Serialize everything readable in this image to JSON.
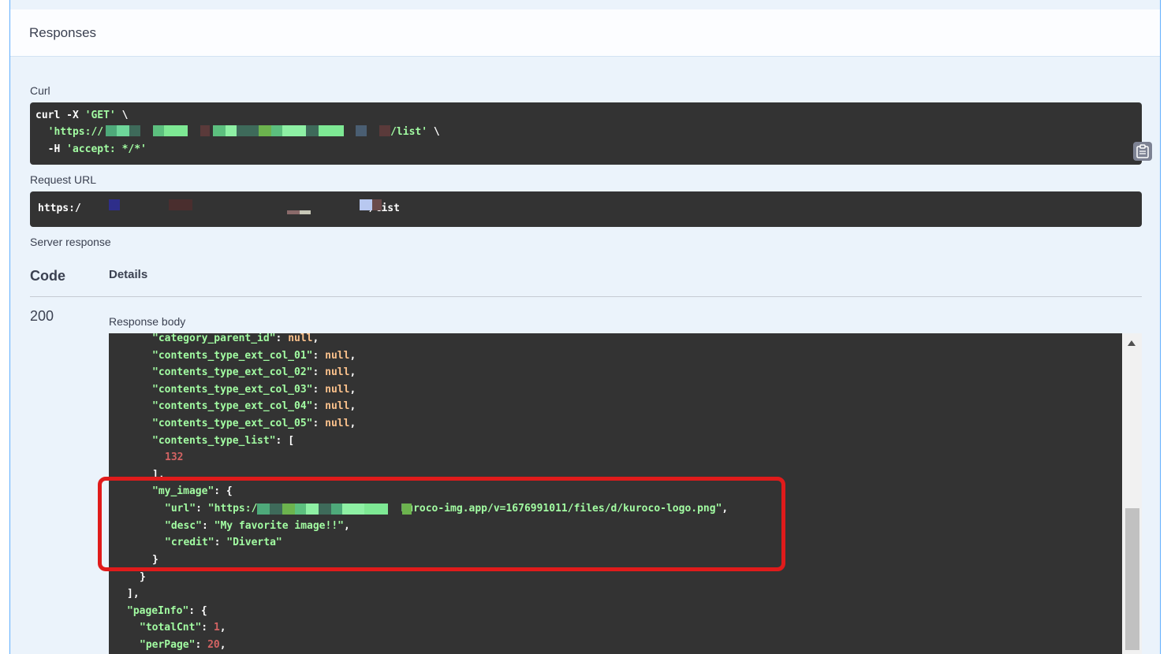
{
  "responses": {
    "title": "Responses"
  },
  "curl": {
    "label": "Curl",
    "line1_cmd": "curl -X ",
    "line1_method": "'GET'",
    "line1_end": " \\",
    "line2_prefix": "  'https://",
    "line2_suffix": "/list'",
    "line2_end": " \\",
    "line3_flag": "  -H ",
    "line3_value": "'accept: */*'"
  },
  "request_url": {
    "label": "Request URL",
    "prefix": "https:/",
    "suffix": "/list"
  },
  "server_response": {
    "label": "Server response",
    "code_header": "Code",
    "details_header": "Details",
    "code": "200",
    "body_label": "Response body"
  },
  "response_body": {
    "l1_key": "\"category_parent_id\"",
    "l1_val": "null",
    "l2_key": "\"contents_type_ext_col_01\"",
    "l2_val": "null",
    "l3_key": "\"contents_type_ext_col_02\"",
    "l3_val": "null",
    "l4_key": "\"contents_type_ext_col_03\"",
    "l4_val": "null",
    "l5_key": "\"contents_type_ext_col_04\"",
    "l5_val": "null",
    "l6_key": "\"contents_type_ext_col_05\"",
    "l6_val": "null",
    "l7_key": "\"contents_type_list\"",
    "l8_num": "132",
    "l10_key": "\"my_image\"",
    "l11_key": "\"url\"",
    "l11_val_prefix": "\"https:/",
    "l11_val_suffix": "kuroco-img.app/v=1676991011/files/d/kuroco-logo.png\"",
    "l12_key": "\"desc\"",
    "l12_val": "\"My favorite image!!\"",
    "l13_key": "\"credit\"",
    "l13_val": "\"Diverta\"",
    "l17_key": "\"pageInfo\"",
    "l18_key": "\"totalCnt\"",
    "l18_val": "1",
    "l19_key": "\"perPage\"",
    "l19_val": "20"
  },
  "colors": {
    "accent": "#61affe",
    "code_bg": "#333333",
    "string": "#a2fca2",
    "number": "#d36363",
    "null": "#fcc28c",
    "highlight": "#e01b1b"
  },
  "icons": {
    "copy": "clipboard-icon"
  }
}
